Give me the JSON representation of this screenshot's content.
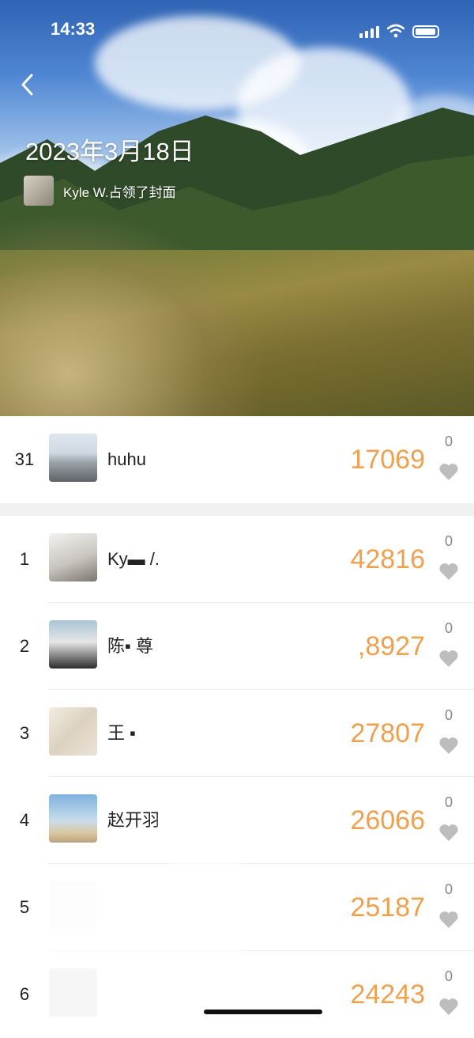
{
  "status_bar": {
    "time": "14:33"
  },
  "cover": {
    "title": "2023年3月18日",
    "owner_text": "Kyle W.占领了封面"
  },
  "my_row": {
    "rank": "31",
    "name": "huhu",
    "steps": "17069",
    "likes": "0"
  },
  "leaderboard": [
    {
      "rank": "1",
      "name": "Ky▬ /.",
      "steps": "42816",
      "likes": "0"
    },
    {
      "rank": "2",
      "name": "陈▪ 尊",
      "steps": ",8927",
      "likes": "0"
    },
    {
      "rank": "3",
      "name": "王 ▪",
      "steps": "27807",
      "likes": "0"
    },
    {
      "rank": "4",
      "name": "赵开羽",
      "steps": "26066",
      "likes": "0"
    },
    {
      "rank": "5",
      "name": "",
      "steps": "25187",
      "likes": "0"
    },
    {
      "rank": "6",
      "name": "",
      "steps": "24243",
      "likes": "0"
    }
  ],
  "icons": {
    "back": "chevron-left-icon",
    "like": "heart-icon",
    "signal": "signal-icon",
    "wifi": "wifi-icon",
    "battery": "battery-icon"
  },
  "colors": {
    "steps": "#f0a04e",
    "like": "#bdbdbd",
    "section_gap": "#f1f1f1"
  }
}
